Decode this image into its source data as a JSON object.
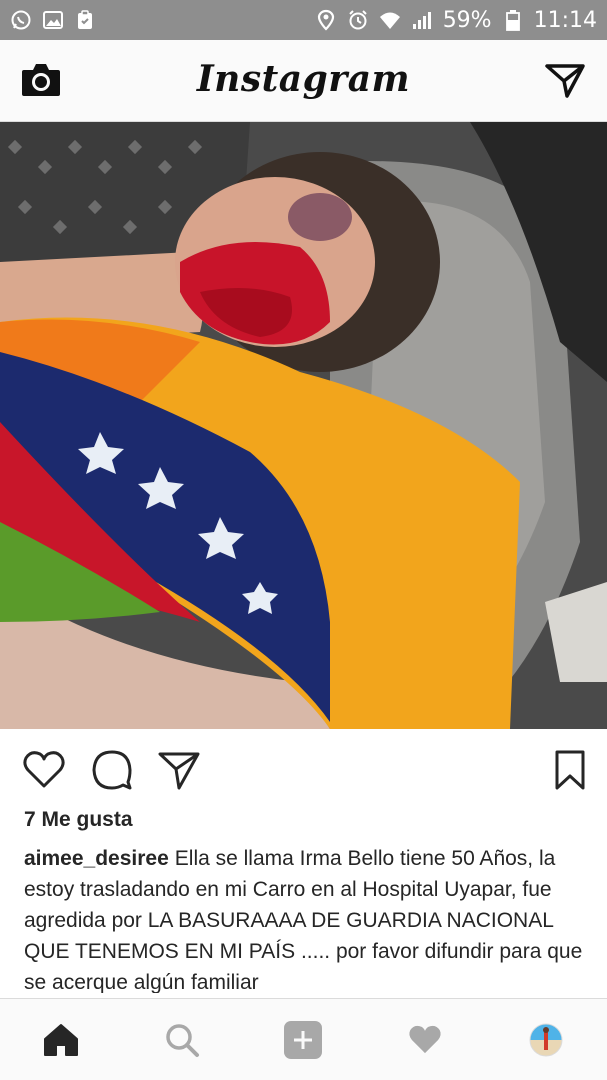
{
  "status_bar": {
    "battery_percent": "59%",
    "time": "11:14",
    "left_icons": [
      "whatsapp-icon",
      "image-icon",
      "clipboard-icon"
    ],
    "right_icons": [
      "location-icon",
      "alarm-icon",
      "wifi-icon",
      "signal-icon",
      "battery-icon"
    ]
  },
  "header": {
    "title": "Instagram",
    "left_icon": "camera-icon",
    "right_icon": "direct-message-icon"
  },
  "post": {
    "likes": "7 Me gusta",
    "username": "aimee_desiree",
    "caption": "Ella se llama Irma Bello tiene 50 Años, la estoy trasladando en mi Carro en al Hospital Uyapar, fue agredida por LA BASURAAAA DE GUARDIA NACIONAL QUE TENEMOS EN MI PAÍS ..... por favor difundir para que se acerque algún familiar",
    "actions": [
      "heart-icon",
      "comment-icon",
      "share-icon",
      "bookmark-icon"
    ]
  },
  "bottom_nav": {
    "items": [
      "home-icon",
      "search-icon",
      "add-post-icon",
      "activity-heart-icon",
      "profile-avatar"
    ]
  },
  "colors": {
    "status_bar": "#8e8e8e",
    "header_bg": "#fafafa",
    "text": "#262626",
    "divider": "#dbdbdb"
  }
}
